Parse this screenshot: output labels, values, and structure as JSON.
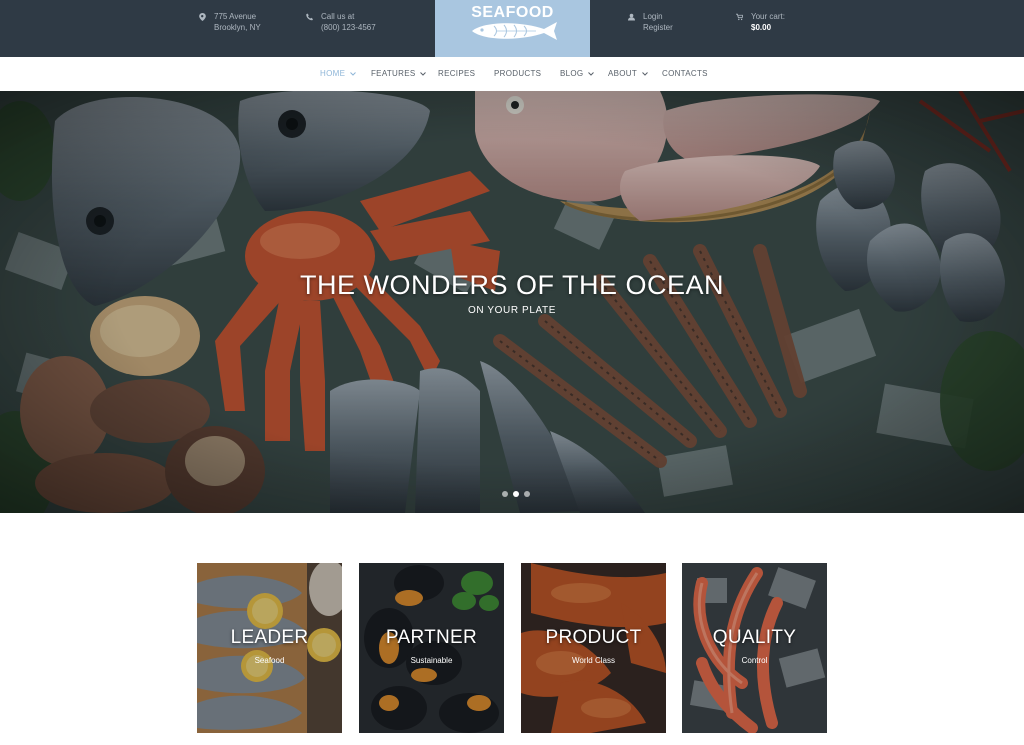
{
  "header": {
    "address": {
      "line1": "775 Avenue",
      "line2": "Brooklyn, NY",
      "icon": "map-pin-icon"
    },
    "phone": {
      "line1": "Call us at",
      "line2": "(800) 123-4567",
      "icon": "phone-icon"
    },
    "logo": {
      "part1": "SEA",
      "part2": "FOOD",
      "icon": "fish-logo-icon"
    },
    "account": {
      "login": "Login",
      "register": "Register",
      "icon": "user-icon"
    },
    "cart": {
      "label": "Your cart:",
      "total": "$0.00",
      "icon": "cart-icon"
    }
  },
  "nav": {
    "items": [
      {
        "label": "HOME",
        "dropdown": true,
        "active": true
      },
      {
        "label": "FEATURES",
        "dropdown": true
      },
      {
        "label": "RECIPES",
        "dropdown": false
      },
      {
        "label": "PRODUCTS",
        "dropdown": false
      },
      {
        "label": "BLOG",
        "dropdown": true
      },
      {
        "label": "ABOUT",
        "dropdown": true
      },
      {
        "label": "CONTACTS",
        "dropdown": false
      }
    ]
  },
  "hero": {
    "title": "THE WONDERS OF THE OCEAN",
    "subtitle": "ON YOUR PLATE",
    "slides": 3,
    "active_slide": 2
  },
  "features": [
    {
      "title": "LEADER",
      "subtitle": "Seafood"
    },
    {
      "title": "PARTNER",
      "subtitle": "Sustainable"
    },
    {
      "title": "PRODUCT",
      "subtitle": "World Class"
    },
    {
      "title": "QUALITY",
      "subtitle": "Control"
    }
  ],
  "colors": {
    "topbar": "#2f3a45",
    "logo_bg": "#a9c6e0",
    "nav_active": "#8fb6d8",
    "nav_text": "#59616a"
  }
}
